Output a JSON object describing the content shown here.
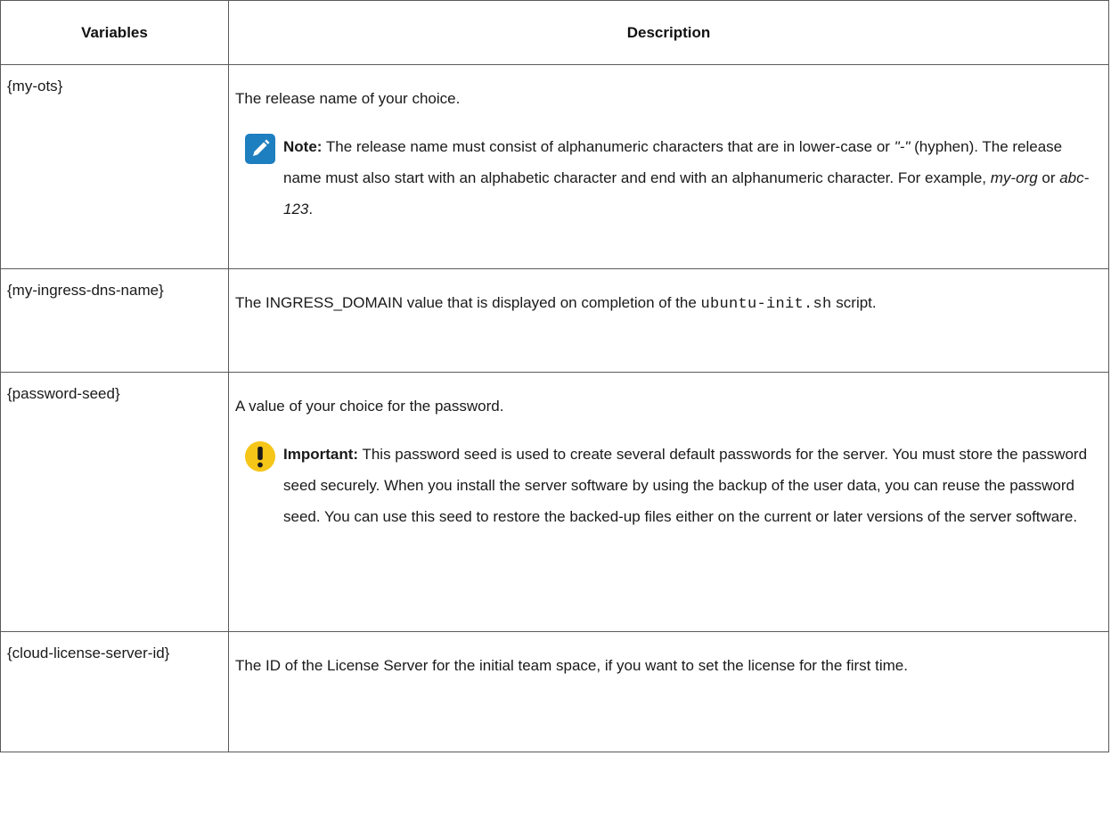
{
  "table": {
    "headers": {
      "variables": "Variables",
      "description": "Description"
    },
    "rows": [
      {
        "variable": "{my-ots}",
        "description": "The release name of your choice.",
        "note": {
          "icon": "pencil-note-icon",
          "label": "Note:",
          "text_1": " The release name must consist of alphanumeric characters that are in lower-case or ",
          "hyphen_quoted": "\"-\"",
          "text_2": " (hyphen). The release name must also start with an alphabetic character and end with an alphanumeric character. For example, ",
          "example_1": "my-org",
          "text_3": " or ",
          "example_2": "abc-123",
          "text_4": "."
        }
      },
      {
        "variable": "{my-ingress-dns-name}",
        "description_1": "The INGRESS_DOMAIN value that is displayed on completion of the ",
        "script_name": "ubuntu-init.sh",
        "description_2": " script."
      },
      {
        "variable": "{password-seed}",
        "description": "A value of your choice for the password.",
        "important": {
          "icon": "exclamation-important-icon",
          "label": "Important:",
          "text": " This password seed is used to create several default passwords for the server. You must store the password seed securely. When you install the server software by using the backup of the user data, you can reuse the password seed. You can use this seed to restore the backed-up files either on the current or later versions of the server software."
        }
      },
      {
        "variable": "{cloud-license-server-id}",
        "description": "The ID of the License Server for the initial team space, if you want to set the license for the first time."
      }
    ]
  },
  "colors": {
    "note_icon_bg": "#1d7fbf",
    "important_icon_bg": "#f5c518",
    "border": "#5a5a5a"
  }
}
